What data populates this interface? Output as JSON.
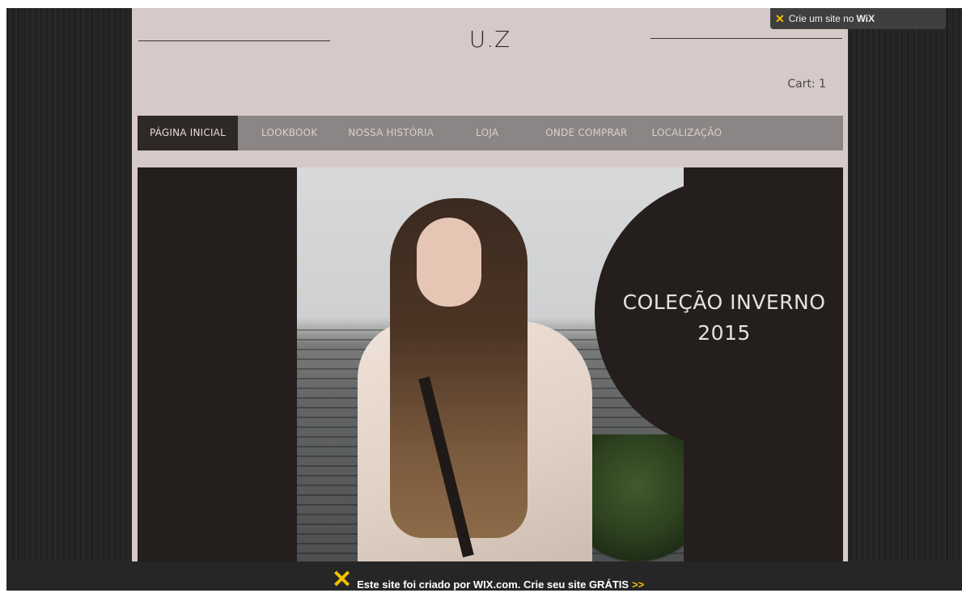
{
  "site": {
    "logo": "U.Z",
    "cart_label": "Cart: 1"
  },
  "nav": {
    "items": [
      {
        "label": "PÁGINA INICIAL",
        "active": true
      },
      {
        "label": "LOOKBOOK",
        "active": false
      },
      {
        "label": "NOSSA HISTÓRIA",
        "active": false
      },
      {
        "label": "LOJA",
        "active": false
      },
      {
        "label": "ONDE COMPRAR",
        "active": false
      },
      {
        "label": "LOCALIZAÇÃO",
        "active": false
      }
    ]
  },
  "hero": {
    "title_line1": "COLEÇÃO INVERNO",
    "title_line2": "2015"
  },
  "wix": {
    "top_badge_text": "Crie um site no",
    "top_badge_brand": "WiX",
    "bottom_banner_text": "Este site foi criado por WIX.com. Crie seu site GRÁTIS",
    "bottom_banner_arrows": ">>",
    "icon_name": "wix-x-icon"
  },
  "colors": {
    "page_bg": "#252525",
    "site_bg": "#d5cac7",
    "nav_bg": "#8b8685",
    "nav_active_bg": "#2e2826",
    "hero_dark": "#241f1d",
    "wix_yellow": "#f2c200"
  }
}
